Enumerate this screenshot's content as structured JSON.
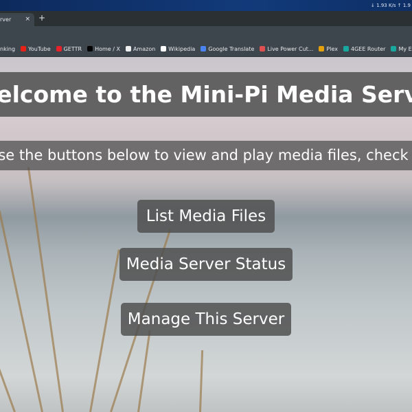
{
  "system": {
    "net_speed": "↓ 1.93 K/s ↑ 1.9"
  },
  "browser": {
    "tab_title": "rver",
    "close": "×",
    "new_tab": "+",
    "bookmarks": [
      {
        "label": "nking",
        "color": "#3c464c"
      },
      {
        "label": "YouTube",
        "color": "#e62117"
      },
      {
        "label": "GETTR",
        "color": "#e8212b"
      },
      {
        "label": "Home / X",
        "color": "#000000"
      },
      {
        "label": "Amazon",
        "color": "#f0f0f0"
      },
      {
        "label": "Wikipedia",
        "color": "#ffffff"
      },
      {
        "label": "Google Translate",
        "color": "#4a84f0"
      },
      {
        "label": "Live Power Cut...",
        "color": "#e05050"
      },
      {
        "label": "Plex",
        "color": "#e5a00d"
      },
      {
        "label": "4GEE Router",
        "color": "#19a8a0"
      },
      {
        "label": "My EE lo",
        "color": "#19a8a0"
      }
    ]
  },
  "page": {
    "title": "Welcome to the Mini-Pi Media Server",
    "subtitle": "Use the buttons below to view and play media files, check DLNA status or manage this server",
    "buttons": [
      "List Media Files",
      "Media Server Status",
      "Manage This Server"
    ]
  }
}
